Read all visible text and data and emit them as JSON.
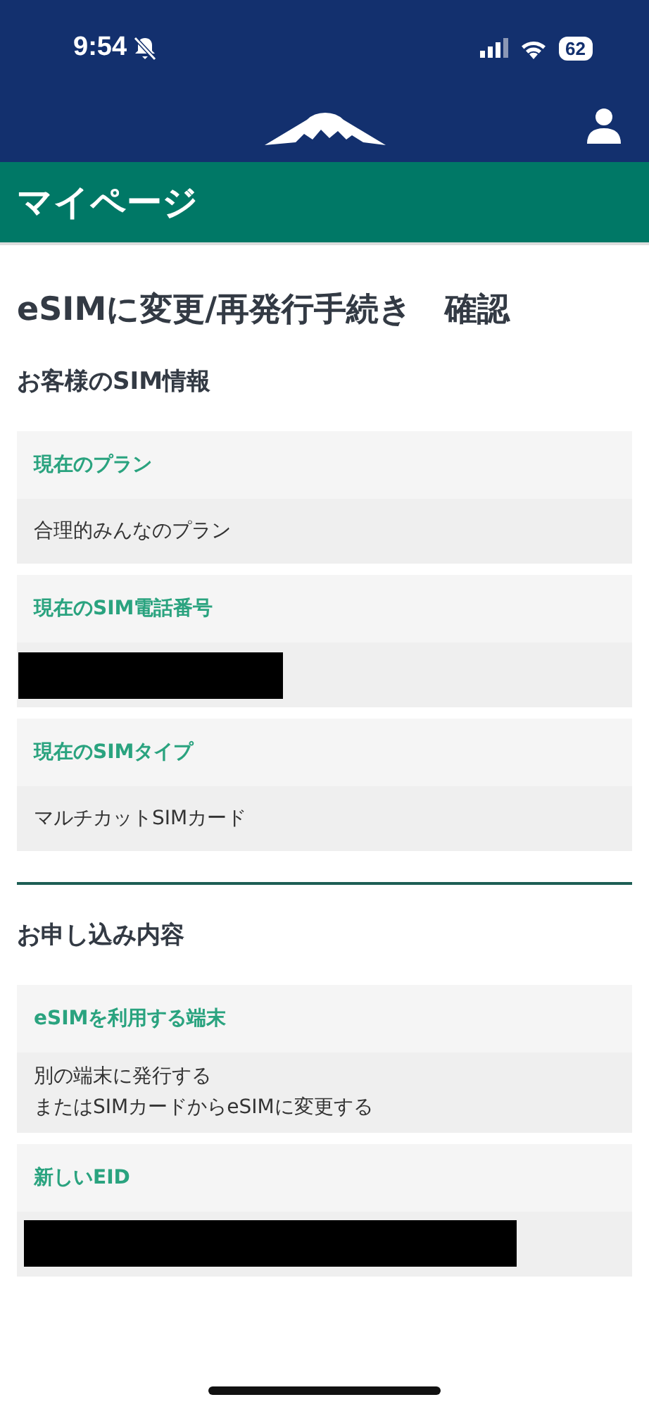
{
  "status_bar": {
    "time": "9:54",
    "battery": "62"
  },
  "page_bar": {
    "title": "マイページ"
  },
  "page_title": "eSIMに変更/再発行手続き　確認",
  "sections": [
    {
      "heading": "お客様のSIM情報",
      "items": [
        {
          "label": "現在のプラン",
          "kind": "text",
          "lines": [
            "合理的みんなのプラン"
          ]
        },
        {
          "label": "現在のSIM電話番号",
          "kind": "redacted"
        },
        {
          "label": "現在のSIMタイプ",
          "kind": "text",
          "lines": [
            "マルチカットSIMカード"
          ]
        }
      ]
    },
    {
      "heading": "お申し込み内容",
      "items": [
        {
          "label": "eSIMを利用する端末",
          "kind": "text",
          "lines": [
            "別の端末に発行する",
            "またはSIMカードからeSIMに変更する"
          ]
        },
        {
          "label": "新しいEID",
          "kind": "redacted"
        }
      ]
    }
  ]
}
